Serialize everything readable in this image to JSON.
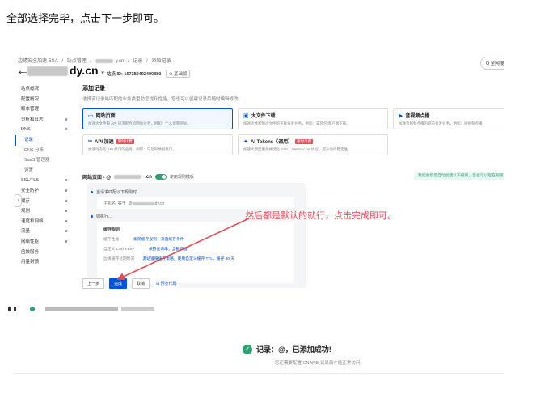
{
  "intro_text": "全部选择完毕，点击下一步即可。",
  "header": {
    "breadcrumb": [
      "边缘安全加速 ESA",
      "/",
      "站点管理",
      "/",
      "y.cn",
      "/",
      "记录",
      "/",
      "添加记录"
    ],
    "domain_suffix": "dy.cn",
    "site_id": "站点 ID: 167282492490880",
    "plan_badge": "⊙ 基础版",
    "top_button": "Q 全网搜索"
  },
  "sidebar": {
    "items": [
      {
        "label": "站点概况",
        "chev": ""
      },
      {
        "label": "配置概况",
        "chev": ""
      },
      {
        "label": "版本管理",
        "chev": ""
      },
      {
        "label": "分析和日志",
        "chev": "∨"
      },
      {
        "label": "DNS",
        "chev": "∧"
      },
      {
        "label": "记录",
        "chev": "",
        "active": true,
        "sub": true
      },
      {
        "label": "DNS 分析",
        "chev": "",
        "sub": true
      },
      {
        "label": "SaaS 管理器",
        "chev": "",
        "sub": true
      },
      {
        "label": "设置",
        "chev": "",
        "sub": true
      },
      {
        "label": "SSL/TLS",
        "chev": "∨"
      },
      {
        "label": "安全防护",
        "chev": "∨"
      },
      {
        "label": "缓存",
        "chev": "∨"
      },
      {
        "label": "规则",
        "chev": "∨"
      },
      {
        "label": "速度和网络",
        "chev": "∨"
      },
      {
        "label": "流量",
        "chev": "∨"
      },
      {
        "label": "网络性能",
        "chev": "∨"
      },
      {
        "label": "函数服务",
        "chev": ""
      },
      {
        "label": "用量封顶",
        "chev": ""
      }
    ]
  },
  "main": {
    "title": "添加记录",
    "subtitle": "选择该记录最匹配的业务类型助您提升性能，您也可以创建记录后随时编辑修改。",
    "cards": [
      {
        "title": "网站页面",
        "desc": "加速大文件和 API 请求配合的网站业务，例如：个人博客网站。",
        "tag": ""
      },
      {
        "title": "大文件下载",
        "desc": "加速大体积静态文件的下载分发业务，例如：安装包/客户端下载。",
        "tag": ""
      },
      {
        "title": "音视频点播",
        "desc": "加速音视频点播内容的分发业务，例如：短视频点播。",
        "tag": ""
      },
      {
        "title": "API 加速",
        "desc": "加速动态的 API 接口的业务，例如：与您的数据接口。",
        "tag": "限时计费"
      },
      {
        "title": "AI Tokens（调用）",
        "desc": "加速大模型服务并优化 SSE、WebSocket 协议，提升访问稳定性。",
        "tag": "限时计费"
      }
    ],
    "section_label_prefix": "网站页面 - @",
    "section_label_suffix": ".cn",
    "section_toggle_label": "使用规则模板",
    "green_hint": "我们会帮您自动创建以下规则，您也可以后在规则引擎中管理。",
    "cond_label": "当请求匹配以下规则时...",
    "host_label": "主机名",
    "host_op": "等于",
    "host_val": "@",
    "host_suffix": "dy.cn",
    "then_label": "则执行...",
    "cache_rule_title": "缓存规则",
    "rows": [
      {
        "k": "缓存性能",
        "v": "跟随缓存规则；对自缓存条件"
      },
      {
        "k": "自定义 CacheKey",
        "v": "保持查询串；全部保留"
      },
      {
        "k": "边缘缓存过期时间",
        "v": "源站遵循缓存策略，使用自定义缓存 TTL，缓存 30 天"
      }
    ],
    "btn_prev": "上一步",
    "btn_done": "完成",
    "btn_cancel": "取消",
    "btn_preview": "⊞ 预览代码"
  },
  "annotation": "然后都是默认的就行，点击完成即可。",
  "success": {
    "title": "记录：@，已添加成功!",
    "sub": "您还需要配置 CNAME 记录后才能正常访问。"
  },
  "colors": {
    "accent": "#0052d9",
    "annotation": "#e34d59",
    "success": "#2ba471"
  }
}
